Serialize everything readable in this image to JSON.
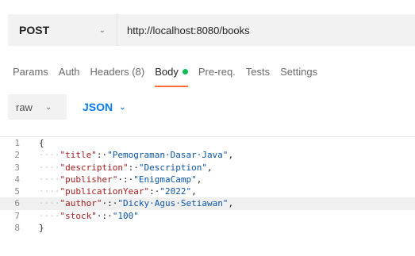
{
  "request": {
    "method": "POST",
    "url": "http://localhost:8080/books"
  },
  "tabs": [
    {
      "label": "Params"
    },
    {
      "label": "Auth"
    },
    {
      "label": "Headers (8)"
    },
    {
      "label": "Body",
      "active": true
    },
    {
      "label": "Pre-req."
    },
    {
      "label": "Tests"
    },
    {
      "label": "Settings"
    }
  ],
  "body_options": {
    "mode": "raw",
    "language": "JSON"
  },
  "editor": {
    "lines": [
      {
        "num": "1",
        "open": "{"
      },
      {
        "num": "2",
        "indent": "····",
        "key": "\"title\"",
        "sep": ":·",
        "value": "\"Pemograman·Dasar·Java\"",
        "comma": ","
      },
      {
        "num": "3",
        "indent": "····",
        "key": "\"description\"",
        "sep": ":·",
        "value": "\"Description\"",
        "comma": ","
      },
      {
        "num": "4",
        "indent": "····",
        "key": "\"publisher\"",
        "sep": "·:·",
        "value": "\"EnigmaCamp\"",
        "comma": ","
      },
      {
        "num": "5",
        "indent": "····",
        "key": "\"publicationYear\"",
        "sep": ":·",
        "value": "\"2022\"",
        "comma": ","
      },
      {
        "num": "6",
        "indent": "····",
        "key": "\"author\"",
        "sep": "·:·",
        "value": "\"Dicky·Agus·Setiawan\"",
        "comma": ","
      },
      {
        "num": "7",
        "indent": "····",
        "key": "\"stock\"",
        "sep": "·:·",
        "value": "\"100\"",
        "comma": ""
      },
      {
        "num": "8",
        "open": "}"
      }
    ]
  },
  "colors": {
    "accent_tab": "#ff6c37",
    "body_dot": "#0cbb52",
    "json_link": "#097bed",
    "json_key": "#a41d1d",
    "json_string": "#0b54a5"
  },
  "icons": {
    "method_dropdown": "chevron-down-icon",
    "raw_dropdown": "chevron-down-icon",
    "json_dropdown": "chevron-down-icon"
  }
}
